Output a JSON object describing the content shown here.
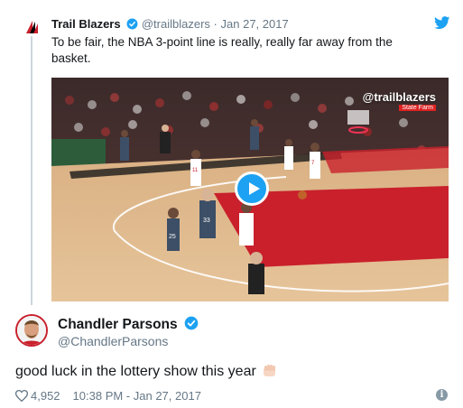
{
  "quoted_tweet": {
    "name": "Trail Blazers",
    "handle": "@trailblazers",
    "separator": "·",
    "date": "Jan 27, 2017",
    "text": "To be fair, the NBA 3-point line is really, really far away from the basket.",
    "video": {
      "watermark": "@trailblazers",
      "watermark_sub": "State Farm",
      "jersey_numbers": [
        "25",
        "33",
        "11",
        "7"
      ]
    }
  },
  "reply_tweet": {
    "name": "Chandler Parsons",
    "handle": "@ChandlerParsons",
    "text": "good luck in the lottery show this year",
    "likes": "4,952",
    "time": "10:38 PM - Jan 27, 2017"
  },
  "icons": {
    "verified": "verified-badge-icon",
    "twitter": "twitter-bird-icon",
    "play": "play-icon",
    "heart": "heart-icon",
    "info": "info-icon",
    "emoji": "raised-fist-emoji-icon"
  },
  "colors": {
    "twitter_blue": "#1da1f2",
    "text_primary": "#14171a",
    "text_secondary": "#657786",
    "blazers_red": "#c9202c"
  }
}
